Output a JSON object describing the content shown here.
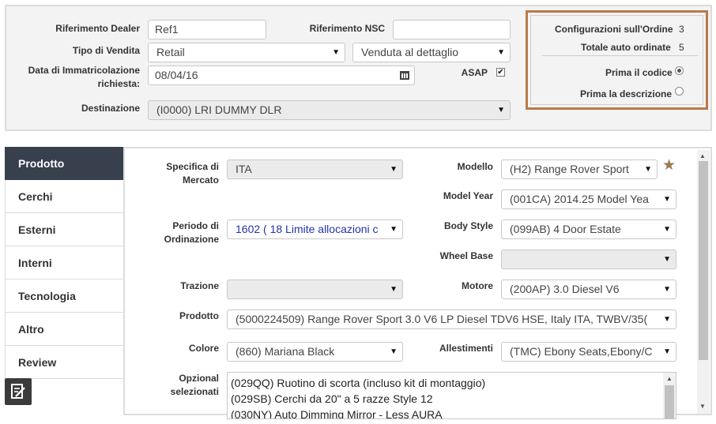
{
  "header": {
    "dealer_ref_label": "Riferimento Dealer",
    "dealer_ref_value": "Ref1",
    "nsc_ref_label": "Riferimento NSC",
    "nsc_ref_value": "",
    "sale_type_label": "Tipo di Vendita",
    "sale_type_value": "Retail",
    "sale_subtype_value": "Venduta al dettaglio",
    "reg_date_label_1": "Data di Immatricolazione",
    "reg_date_label_2": "richiesta:",
    "reg_date_value": "08/04/16",
    "asap_label": "ASAP",
    "asap_checked": true,
    "destination_label": "Destinazione",
    "destination_value": "(I0000) LRI DUMMY DLR"
  },
  "summary": {
    "config_label": "Configurazioni sull'Ordine",
    "config_value": "3",
    "total_label": "Totale auto ordinate",
    "total_value": "5",
    "code_first_label": "Prima il codice",
    "desc_first_label": "Prima la descrizione",
    "selected": "code_first"
  },
  "sidebar": {
    "tabs": [
      "Prodotto",
      "Cerchi",
      "Esterni",
      "Interni",
      "Tecnologia",
      "Altro",
      "Review"
    ],
    "active": "Prodotto"
  },
  "product": {
    "market_label_1": "Specifica di",
    "market_label_2": "Mercato",
    "market_value": "ITA",
    "model_label": "Modello",
    "model_value": "(H2) Range Rover Sport",
    "model_year_label": "Model Year",
    "model_year_value": "(001CA) 2014.25 Model Yea",
    "period_label_1": "Periodo di",
    "period_label_2": "Ordinazione",
    "period_value": "1602 ( 18 Limite allocazioni c",
    "body_style_label": "Body Style",
    "body_style_value": "(099AB) 4 Door Estate",
    "wheelbase_label": "Wheel Base",
    "wheelbase_value": "",
    "traction_label": "Trazione",
    "traction_value": "",
    "engine_label": "Motore",
    "engine_value": "(200AP) 3.0 Diesel V6",
    "product_label": "Prodotto",
    "product_value": "(5000224509) Range Rover Sport 3.0 V6 LP Diesel TDV6 HSE, Italy ITA, TWBV/35(",
    "color_label": "Colore",
    "color_value": "(860) Mariana Black",
    "trim_label": "Allestimenti",
    "trim_value": "(TMC) Ebony Seats,Ebony/C",
    "options_label_1": "Opzional",
    "options_label_2": "selezionati",
    "options": [
      "(029QQ) Ruotino di scorta (incluso kit di montaggio)",
      "(029SB) Cerchi da 20\" a 5 razze Style 12",
      "(030NY) Auto Dimming Mirror - Less AURA"
    ]
  },
  "colors": {
    "accent_border": "#b87a4b",
    "active_tab": "#38404e",
    "period_text": "#2233aa"
  },
  "icons": {
    "calendar": "calendar-icon",
    "favorite": "star-icon",
    "notes": "notes-icon"
  }
}
